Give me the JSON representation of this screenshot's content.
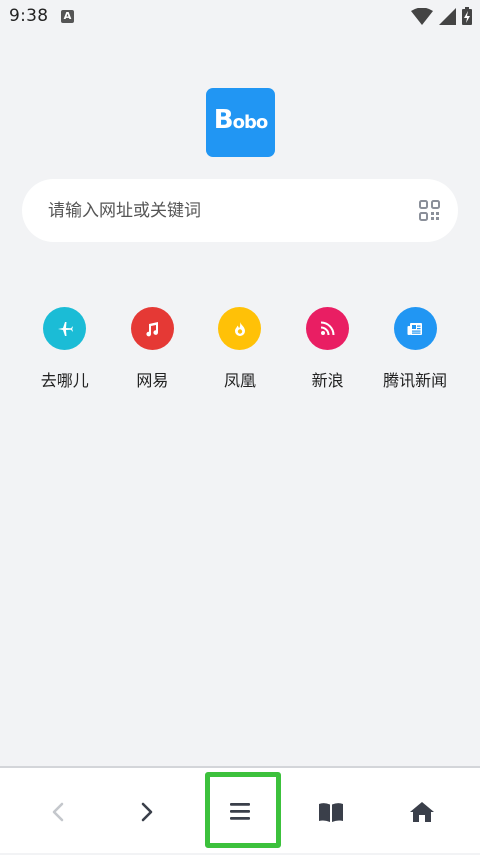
{
  "status_bar": {
    "time": "9:38",
    "notification_icon": "A"
  },
  "logo": {
    "text_big": "B",
    "text_small": "obo",
    "color": "#2196f3"
  },
  "search": {
    "placeholder": "请输入网址或关键词",
    "scan_icon": "qr-scan-icon"
  },
  "quick_links": [
    {
      "label": "去哪儿",
      "icon": "airplane-icon",
      "color": "#1bbcd6"
    },
    {
      "label": "网易",
      "icon": "music-note-icon",
      "color": "#e53935"
    },
    {
      "label": "凤凰",
      "icon": "flame-icon",
      "color": "#ffc107"
    },
    {
      "label": "新浪",
      "icon": "rss-icon",
      "color": "#e91e63"
    },
    {
      "label": "腾讯新闻",
      "icon": "newspaper-icon",
      "color": "#2196f3"
    }
  ],
  "bottom_nav": {
    "items": [
      {
        "icon": "back-arrow-icon",
        "enabled": false
      },
      {
        "icon": "forward-arrow-icon",
        "enabled": true
      },
      {
        "icon": "menu-icon",
        "enabled": true,
        "highlighted": true
      },
      {
        "icon": "bookmarks-icon",
        "enabled": true
      },
      {
        "icon": "home-icon",
        "enabled": true
      }
    ]
  }
}
